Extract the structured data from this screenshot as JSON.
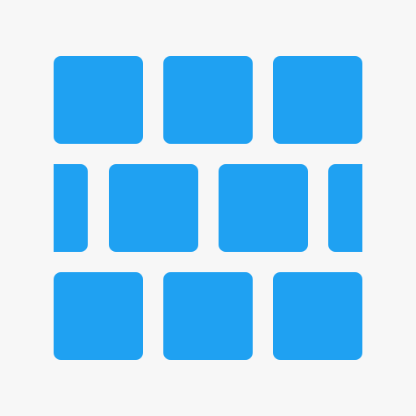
{
  "colors": {
    "background": "#F7F7F7",
    "brick": "#1FA1F2"
  },
  "icon": {
    "name": "brick-wall-icon",
    "rows": 3
  }
}
